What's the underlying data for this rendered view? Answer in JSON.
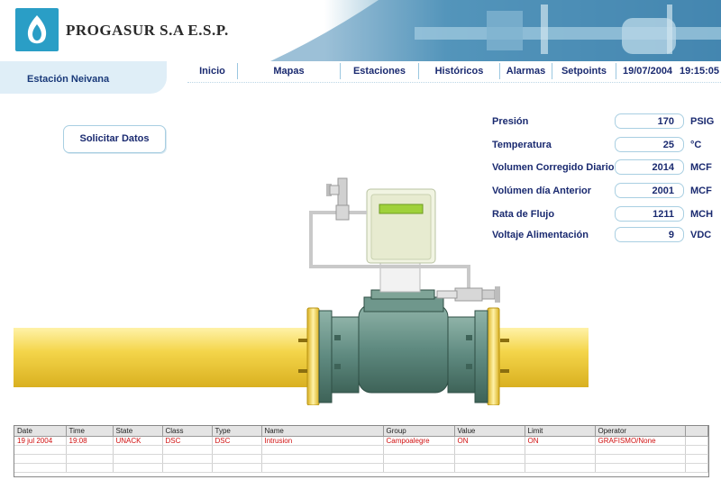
{
  "header": {
    "company": "PROGASUR S.A  E.S.P."
  },
  "station": "Estación Neivana",
  "nav": {
    "items": [
      {
        "label": "Inicio"
      },
      {
        "label": "Mapas"
      },
      {
        "label": "Estaciones"
      },
      {
        "label": "Históricos"
      },
      {
        "label": "Alarmas"
      },
      {
        "label": "Setpoints"
      }
    ],
    "date": "19/07/2004",
    "time": "19:15:05"
  },
  "request_button": "Solicitar Datos",
  "readings": [
    {
      "label": "Presión",
      "value": "170",
      "unit": "PSIG"
    },
    {
      "label": "Temperatura",
      "value": "25",
      "unit": "°C"
    },
    {
      "label": "Volumen Corregido Diario",
      "value": "2014",
      "unit": "MCF"
    },
    {
      "label": "Volúmen día Anterior",
      "value": "2001",
      "unit": "MCF"
    },
    {
      "label": "Rata de Flujo",
      "value": "1211",
      "unit": "MCH"
    },
    {
      "label": "Voltaje Alimentación",
      "value": "9",
      "unit": "VDC"
    }
  ],
  "alarm_table": {
    "columns": [
      "Date",
      "Time",
      "State",
      "Class",
      "Type",
      "Name",
      "Group",
      "Value",
      "Limit",
      "Operator"
    ],
    "rows": [
      [
        "19 jul 2004",
        "19:08",
        "UNACK",
        "DSC",
        "DSC",
        "Intrusion",
        "Campoalegre",
        "ON",
        "ON",
        "GRAFISMO/None"
      ]
    ]
  },
  "colors": {
    "accent": "#1a2a70",
    "alarm_text": "#d01010",
    "pipe": "#f2d44a",
    "meter_body": "#5f8a80"
  }
}
